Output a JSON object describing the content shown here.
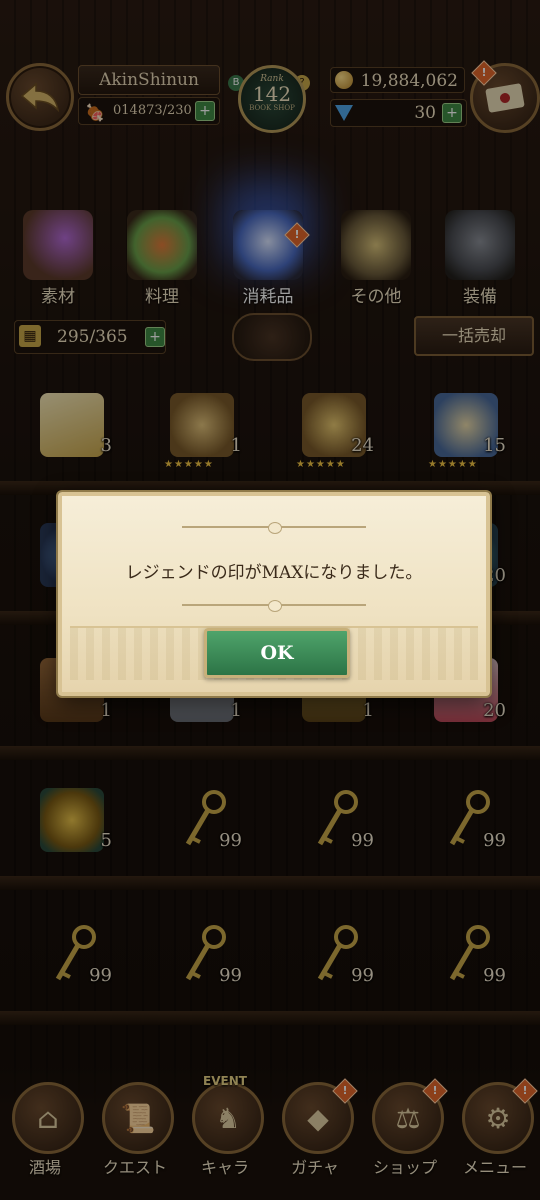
{
  "header": {
    "player_name": "AkinShinun",
    "stamina": "014873/230",
    "rank_label": "Rank",
    "rank_value": "142",
    "rank_sub": "BOOK SHOP",
    "coins": "19,884,062",
    "gems": "30"
  },
  "categories": [
    {
      "label": "素材",
      "icon": "material-bottles-icon"
    },
    {
      "label": "料理",
      "icon": "food-platter-icon"
    },
    {
      "label": "消耗品",
      "icon": "consumables-chest-icon",
      "active": true
    },
    {
      "label": "その他",
      "icon": "trophy-misc-icon"
    },
    {
      "label": "装備",
      "icon": "armor-equipment-icon"
    }
  ],
  "storage": {
    "value": "295/365"
  },
  "sell_all_label": "一括売却",
  "item_rows": [
    [
      {
        "name": "card-pack-item",
        "count": "3"
      },
      {
        "name": "legend-seal-scroll-item",
        "count": "1",
        "stars": "★★★★★"
      },
      {
        "name": "legend-seal-scroll-item",
        "count": "24",
        "stars": "★★★★★"
      },
      {
        "name": "legend-seal-scroll-item",
        "count": "15",
        "stars": "★★★★★"
      }
    ],
    [
      {
        "name": "blue-orb-item",
        "count": ""
      },
      {
        "name": "item",
        "count": ""
      },
      {
        "name": "item",
        "count": ""
      },
      {
        "name": "blue-orb-item",
        "count": "20"
      }
    ],
    [
      {
        "name": "treasure-chest-item",
        "count": "1"
      },
      {
        "name": "silver-chest-item",
        "count": "1"
      },
      {
        "name": "gold-frame-item",
        "count": "1"
      },
      {
        "name": "gift-box-item",
        "count": "20"
      }
    ],
    [
      {
        "name": "gold-coin-pouch-item",
        "count": "5"
      },
      {
        "name": "golden-key-item",
        "count": "99"
      },
      {
        "name": "golden-key-item",
        "count": "99"
      },
      {
        "name": "golden-key-item",
        "count": "99"
      }
    ],
    [
      {
        "name": "golden-key-item",
        "count": "99"
      },
      {
        "name": "golden-key-item",
        "count": "99"
      },
      {
        "name": "golden-key-item",
        "count": "99"
      },
      {
        "name": "golden-key-item",
        "count": "99"
      }
    ]
  ],
  "dialog": {
    "message": "レジェンドの印がMAXになりました。",
    "ok_label": "OK"
  },
  "bottom_nav": [
    {
      "label": "酒場",
      "icon": "tavern-icon"
    },
    {
      "label": "クエスト",
      "icon": "quest-scroll-icon"
    },
    {
      "label": "キャラ",
      "icon": "character-knight-icon",
      "tag": "EVENT"
    },
    {
      "label": "ガチャ",
      "icon": "gacha-crystal-icon"
    },
    {
      "label": "ショップ",
      "icon": "shop-sign-icon"
    },
    {
      "label": "メニュー",
      "icon": "menu-gear-icon"
    }
  ],
  "colors": {
    "accent_green": "#2c7446",
    "parchment": "#efe2c2",
    "wood_dark": "#1a120c",
    "alert_orange": "#e2672a"
  }
}
